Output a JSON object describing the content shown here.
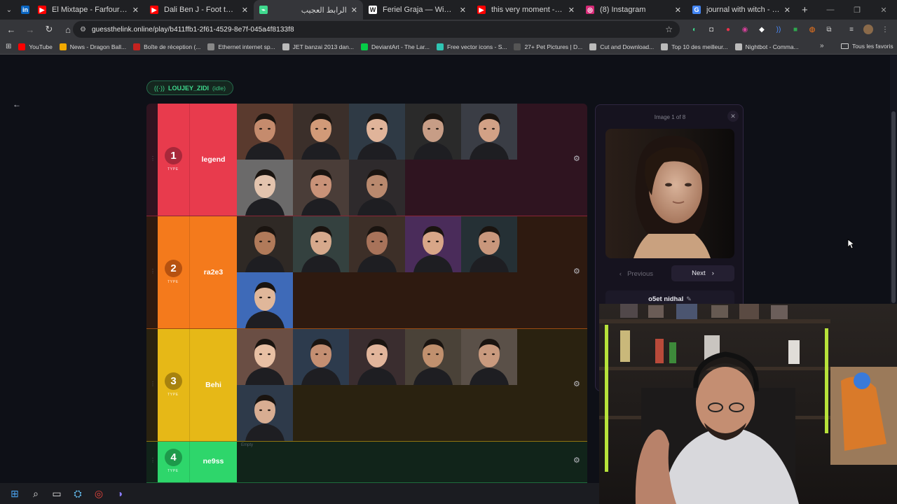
{
  "browser": {
    "tabs": [
      {
        "title": "",
        "favicon": "linkedin-icon",
        "color": "#0a66c2",
        "glyph": "in"
      },
      {
        "title": "El Mixtape - Farfouri - YouTube",
        "favicon": "youtube-icon",
        "color": "#ff0000",
        "glyph": "▶"
      },
      {
        "title": "Dali Ben J - Foot tu - YouTube",
        "favicon": "youtube-icon",
        "color": "#ff0000",
        "glyph": "▶"
      },
      {
        "title": "الرابط العجيب",
        "favicon": "site-icon",
        "color": "#3fd98e",
        "glyph": "⌁"
      },
      {
        "title": "Feriel Graja — Wikipédia",
        "favicon": "wikipedia-icon",
        "color": "#ffffff",
        "glyph": "W"
      },
      {
        "title": "this very moment - YouTube",
        "favicon": "youtube-icon",
        "color": "#ff0000",
        "glyph": "▶"
      },
      {
        "title": "(8) Instagram",
        "favicon": "instagram-icon",
        "color": "#d62976",
        "glyph": "◎"
      },
      {
        "title": "journal with witch - Recherche",
        "favicon": "google-icon",
        "color": "#4285f4",
        "glyph": "G"
      }
    ],
    "active_tab_index": 3,
    "new_tab": "+",
    "url": "guessthelink.online/play/b411ffb1-2f61-4529-8e7f-045a4f8133f8",
    "bookmarks": [
      {
        "label": "YouTube",
        "color": "#ff0000"
      },
      {
        "label": "News - Dragon Ball...",
        "color": "#f2a900"
      },
      {
        "label": "Boîte de réception (...",
        "color": "#c5221f"
      },
      {
        "label": "Ethernet internet sp...",
        "color": "#888888"
      },
      {
        "label": "JET banzai 2013 dan...",
        "color": "#bbbbbb"
      },
      {
        "label": "DeviantArt - The Lar...",
        "color": "#05cc47"
      },
      {
        "label": "Free vector icons - S...",
        "color": "#2fc5b3"
      },
      {
        "label": "27+ Pet Pictures | D...",
        "color": "#555555"
      },
      {
        "label": "Cut and Download...",
        "color": "#bbbbbb"
      },
      {
        "label": "Top 10 des meilleur...",
        "color": "#bbbbbb"
      },
      {
        "label": "Nightbot - Comma...",
        "color": "#bbbbbb"
      }
    ],
    "all_bookmarks": "Tous les favoris"
  },
  "game": {
    "player": {
      "name": "LOUJEY_ZIDI",
      "status": "(idle)"
    },
    "tiers": [
      {
        "rank": "1",
        "type_label": "TYPE",
        "name": "legend",
        "color": "#e83b4d",
        "num_bg": "#a8283a",
        "bg": "#2f1420",
        "line": "#8a2535",
        "tiles": 8
      },
      {
        "rank": "2",
        "type_label": "TYPE",
        "name": "ra2e3",
        "color": "#f47a1c",
        "num_bg": "#b65210",
        "bg": "#2e1a10",
        "line": "#9a4b12",
        "tiles": 6
      },
      {
        "rank": "3",
        "type_label": "TYPE",
        "name": "Behi",
        "color": "#e6b817",
        "num_bg": "#a7820e",
        "bg": "#2a2210",
        "line": "#8f7410",
        "tiles": 6
      },
      {
        "rank": "4",
        "type_label": "TYPE",
        "name": "ne9ss",
        "color": "#2ed66b",
        "num_bg": "#1d9a4b",
        "bg": "#11241a",
        "line": "#1e6b3c",
        "tiles": 0
      }
    ],
    "empty_hint": "Empty",
    "panel": {
      "counter": "Image 1 of 8",
      "close": "✕",
      "prev_label": "Previous",
      "next_label": "Next",
      "guess": "o5et nidhal"
    }
  }
}
